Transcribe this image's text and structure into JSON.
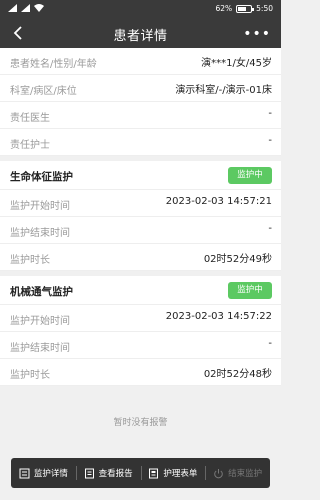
{
  "status_bar": {
    "battery": "62%",
    "time": "5:50"
  },
  "header": {
    "title": "患者详情",
    "more": "•••"
  },
  "patient": [
    {
      "label": "患者姓名/性别/年龄",
      "value": "演***1/女/45岁"
    },
    {
      "label": "科室/病区/床位",
      "value": "演示科室/-/演示-01床"
    },
    {
      "label": "责任医生",
      "value": "-"
    },
    {
      "label": "责任护士",
      "value": "-"
    }
  ],
  "vital_signs": {
    "title": "生命体征监护",
    "status": "监护中",
    "rows": [
      {
        "label": "监护开始时间",
        "value": "2023-02-03 14:57:21"
      },
      {
        "label": "监护结束时间",
        "value": "-"
      },
      {
        "label": "监护时长",
        "value": "02时52分49秒"
      }
    ]
  },
  "ventilation": {
    "title": "机械通气监护",
    "status": "监护中",
    "rows": [
      {
        "label": "监护开始时间",
        "value": "2023-02-03 14:57:22"
      },
      {
        "label": "监护结束时间",
        "value": "-"
      },
      {
        "label": "监护时长",
        "value": "02时52分48秒"
      }
    ]
  },
  "empty_message": "暂时没有报警",
  "toolbar": {
    "details": "监护详情",
    "report": "查看报告",
    "nursing_form": "护理表单",
    "end_monitor": "结束监护"
  },
  "colors": {
    "header_bg": "#3a3a3a",
    "badge_green": "#5cc962",
    "toolbar_bg": "#333333"
  }
}
